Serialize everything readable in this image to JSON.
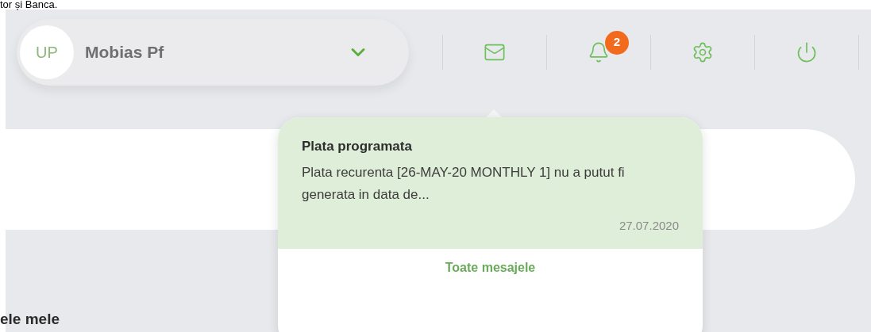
{
  "page_fragment": "tor și Banca.",
  "profile": {
    "initials": "UP",
    "name": "Mobias Pf"
  },
  "toolbar": [
    {
      "kind": "mail"
    },
    {
      "kind": "bell",
      "badge": "2"
    },
    {
      "kind": "settings"
    },
    {
      "kind": "power"
    }
  ],
  "popup": {
    "messages": [
      {
        "title": "Plata programata",
        "body": "Plata recurenta [26-MAY-20 MONTHLY 1] nu a putut fi generata in data de...",
        "date": "27.07.2020"
      }
    ],
    "link": "Toate mesajele"
  },
  "section_heading": "ele mele"
}
